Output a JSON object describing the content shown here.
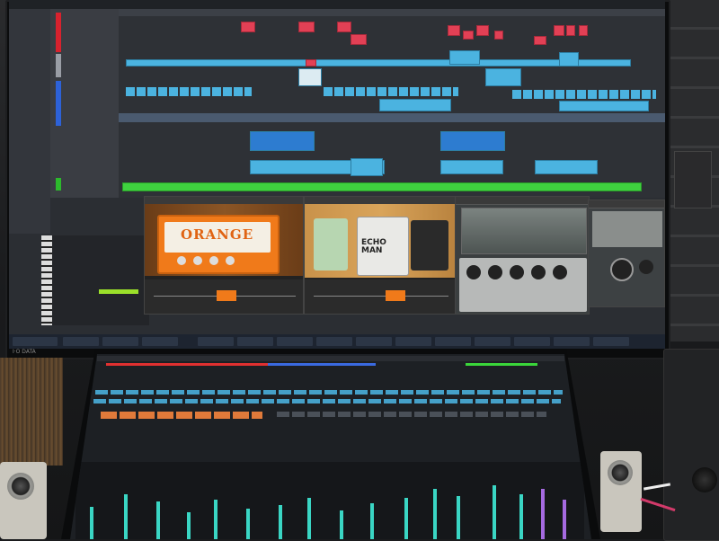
{
  "scene": "Photo of a music production desk: a large monitor showing a DAW arrangement with amp and effect plugin windows, and a touchscreen below showing a mixer console",
  "plugins": {
    "amp_logo": "ORANGE",
    "pedal_name": "ECHO MAN"
  },
  "monitor": {
    "brand": "I·O DATA"
  },
  "colors": {
    "clip_blue": "#4bb3e0",
    "clip_red": "#e24055",
    "clip_green": "#3fd23f",
    "amp_orange": "#f07a1a",
    "mixer_cyan": "#3ad6c4",
    "channel_orange": "#e07a3a"
  }
}
